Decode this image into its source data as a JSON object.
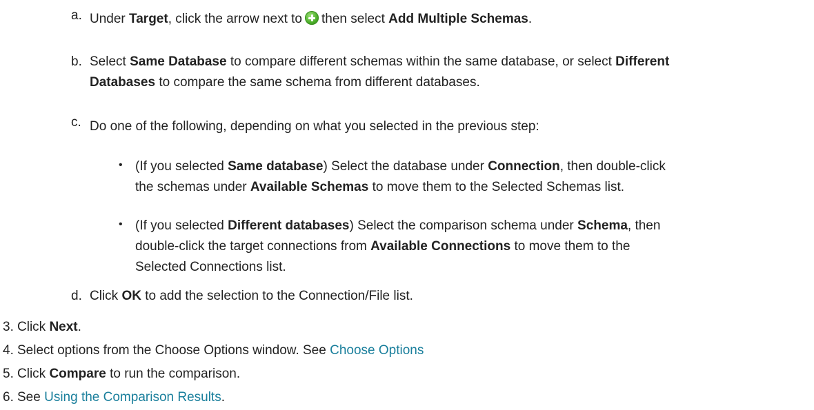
{
  "sub_steps": {
    "a": {
      "letter": "a.",
      "t1": "Under ",
      "b1": "Target",
      "t2": ", click the arrow next to",
      "icon": "add-icon",
      "t3": "then select ",
      "b2": "Add Multiple Schemas",
      "t4": "."
    },
    "b": {
      "letter": "b.",
      "t1": "Select ",
      "b1": "Same Database",
      "t2": " to compare different schemas within the same database, or select ",
      "b2": "Different",
      "b3": "Databases",
      "t3": " to compare the same schema from different databases."
    },
    "c": {
      "letter": "c.",
      "text": "Do one of the following, depending on what you selected in the previous step:",
      "bullets": [
        {
          "bullet": "•",
          "t1": "(If you selected ",
          "b1": "Same database",
          "t2": ") Select the database under ",
          "b2": "Connection",
          "t3": ", then double-click",
          "t4": "the schemas under ",
          "b3": "Available Schemas",
          "t5": " to move them to the Selected Schemas list."
        },
        {
          "bullet": "•",
          "t1": "(If you selected ",
          "b1": "Different databases",
          "t2": ") Select the comparison schema under ",
          "b2": "Schema",
          "t3": ", then",
          "t4": "double-click the target connections from ",
          "b3": "Available Connections",
          "t5": " to move them to the",
          "t6": "Selected Connections list."
        }
      ]
    },
    "d": {
      "letter": "d.",
      "t1": "Click ",
      "b1": "OK",
      "t2": " to add the selection to the Connection/File list."
    }
  },
  "steps": [
    {
      "num": "3.",
      "t1": "Click ",
      "b1": "Next",
      "t2": "."
    },
    {
      "num": "4.",
      "t1": "Select options from the Choose Options window. See ",
      "link": "Choose Options"
    },
    {
      "num": "5.",
      "t1": "Click ",
      "b1": "Compare",
      "t2": " to run the comparison."
    },
    {
      "num": "6.",
      "t1": "See ",
      "link": "Using the Comparison Results",
      "t2": "."
    }
  ],
  "colors": {
    "text": "#222222",
    "link": "#1a7f9c",
    "icon": "#4caf2a"
  }
}
